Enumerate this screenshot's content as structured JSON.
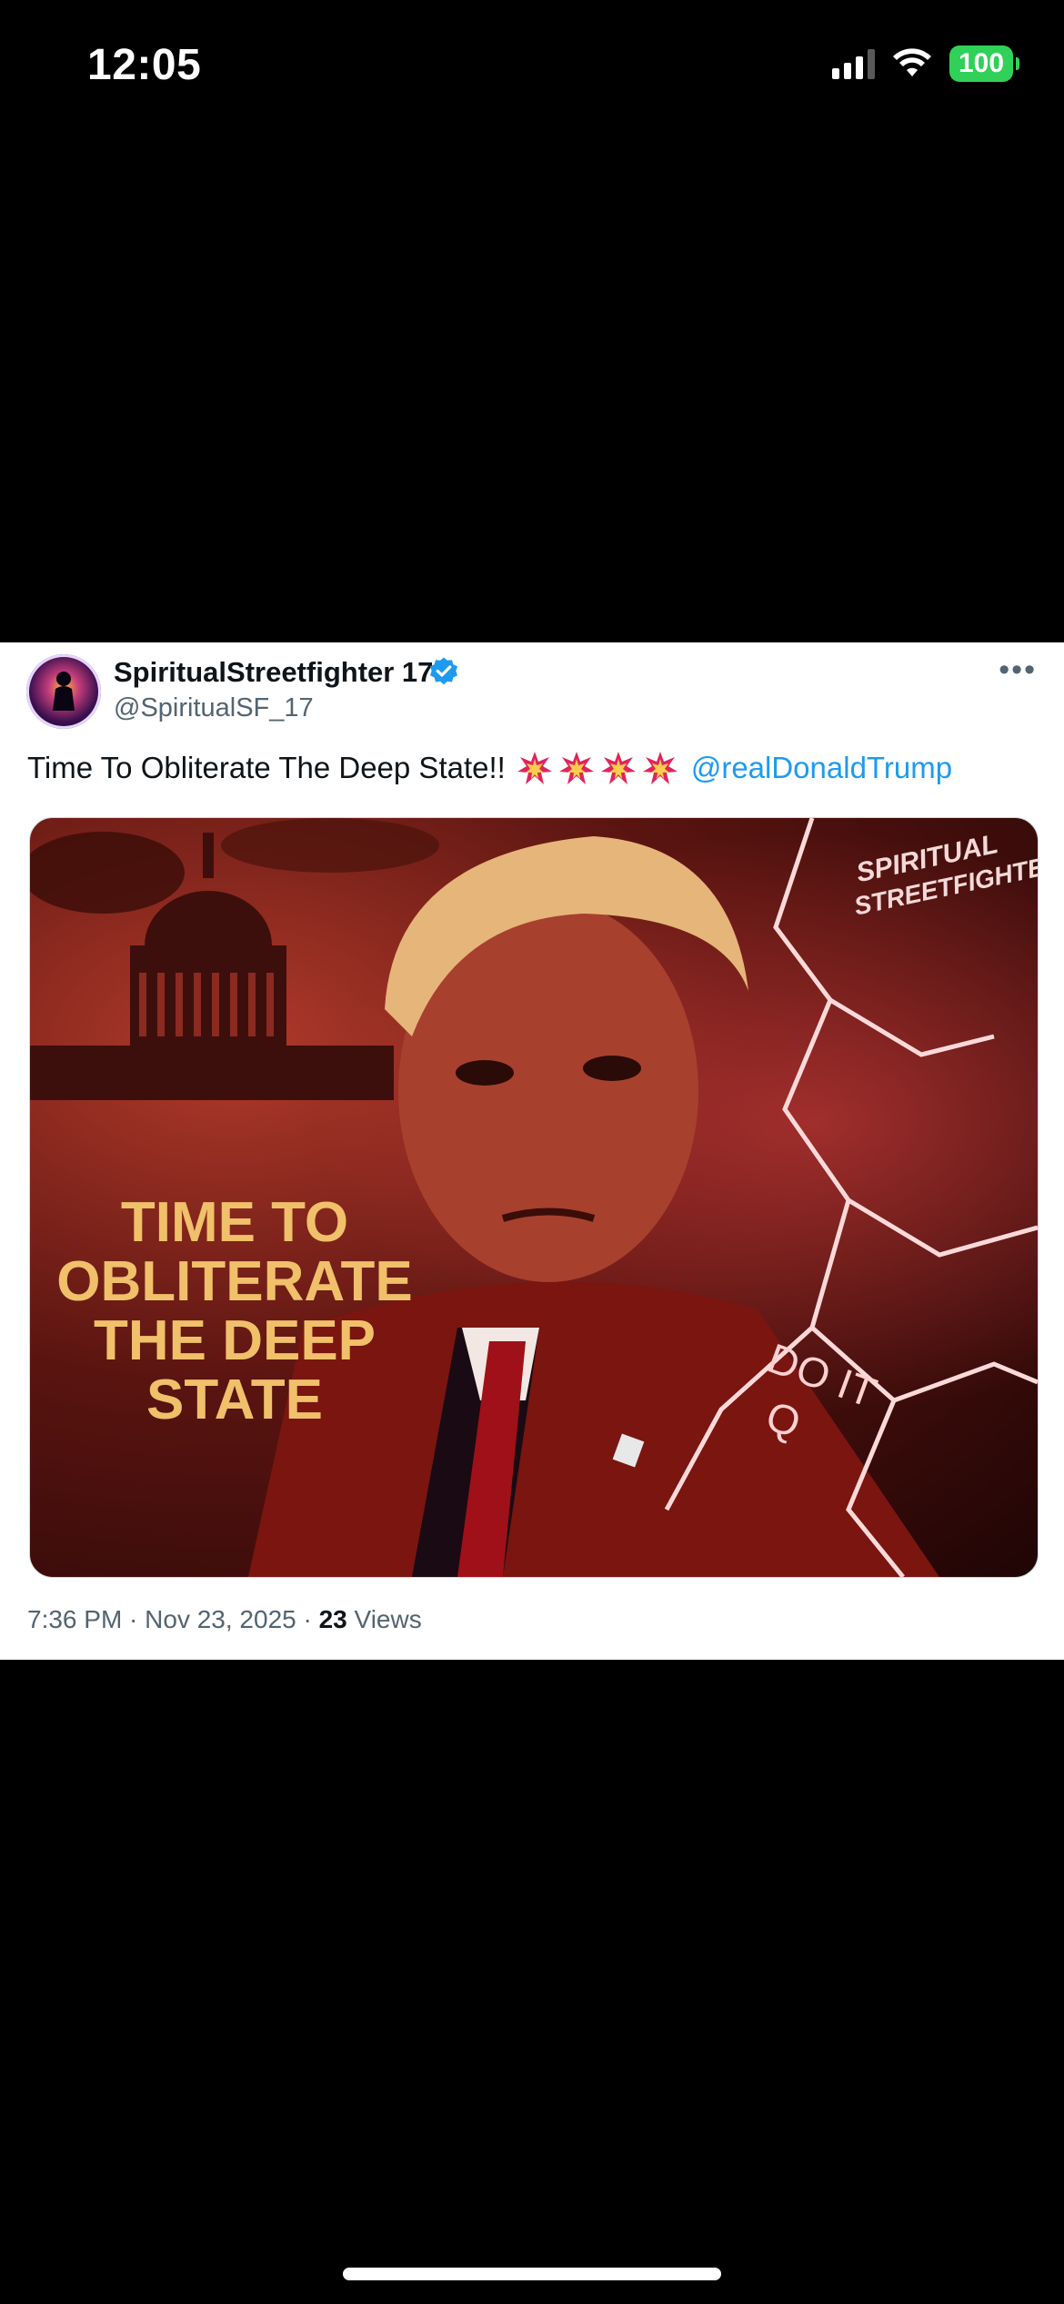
{
  "status_bar": {
    "time": "12:05",
    "battery": "100",
    "icons": [
      "signal-icon",
      "wifi-icon",
      "battery-icon"
    ]
  },
  "tweet": {
    "display_name": "SpiritualStreetfighter 17",
    "handle": "@SpiritualSF_17",
    "verified": true,
    "text_before": "Time To Obliterate The Deep State!!",
    "emoji_count": 4,
    "mention": "@realDonaldTrump",
    "image": {
      "overlay_text_lines": [
        "TIME TO",
        "OBLITERATE",
        "THE DEEP",
        "STATE"
      ],
      "watermark_lines": [
        "SPIRITUAL",
        "STREETFIGHTER"
      ],
      "jacket_text_lines": [
        "DO IT",
        "Q"
      ]
    },
    "meta": {
      "time_date": "7:36 PM · Nov 23, 2025 · ",
      "views_count": "23",
      "views_label": " Views"
    }
  },
  "colors": {
    "verified_blue": "#1d9bf0",
    "battery_green": "#30d158",
    "link_blue": "#1d9bf0"
  }
}
